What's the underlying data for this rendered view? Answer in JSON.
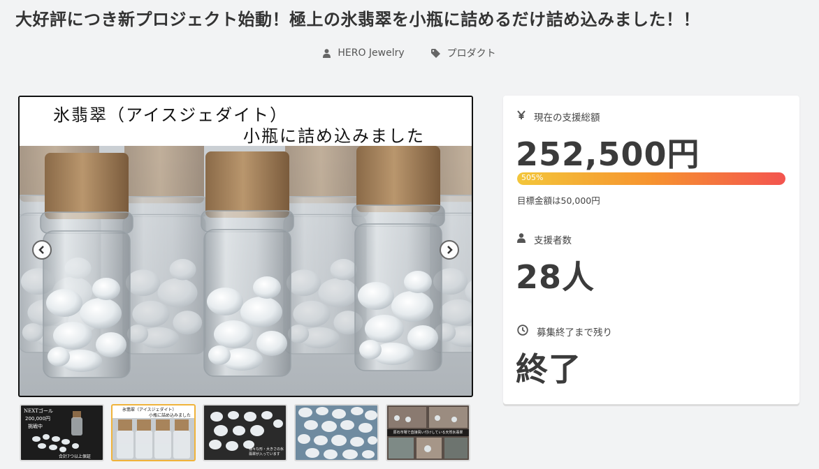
{
  "page": {
    "title": "大好評につき新プロジェクト始動！極上の氷翡翠を小瓶に詰めるだけ詰め込みました！！"
  },
  "meta": {
    "author": "HERO Jewelry",
    "author_icon": "user-icon",
    "category": "プロダクト",
    "category_icon": "tag-icon"
  },
  "gallery": {
    "banner_line1": "氷翡翠（アイスジェダイト）",
    "banner_line2": "小瓶に詰め込みました",
    "thumb1_text1": "NEXTゴール",
    "thumb1_text2": "200,000円",
    "thumb1_text3": "挑戦中",
    "thumb1_text4": "合計7つ以上保証",
    "thumb2_text1": "氷翡翠（アイスジェダイト）",
    "thumb2_text2": "小瓶に詰め込みました",
    "thumb3_text": "様々な形・大きさの氷翡翠が入っています",
    "thumb5_text": "原石市場で直接買い付けしている天然氷翡翠",
    "active_thumb": 2
  },
  "stats": {
    "total_label": "現在の支援総額",
    "total_icon": "yen-icon",
    "total_value": "252,500円",
    "progress_text": "505%",
    "progress_percent": 505,
    "goal_text": "目標金額は50,000円",
    "backers_label": "支援者数",
    "backers_icon": "user-icon",
    "backers_value": "28人",
    "remaining_label": "募集終了まで残り",
    "remaining_icon": "clock-icon",
    "remaining_value": "終了"
  },
  "colors": {
    "progress_start": "#f3c63a",
    "progress_end": "#f3544f",
    "active_thumb_border": "#f0b33a"
  }
}
